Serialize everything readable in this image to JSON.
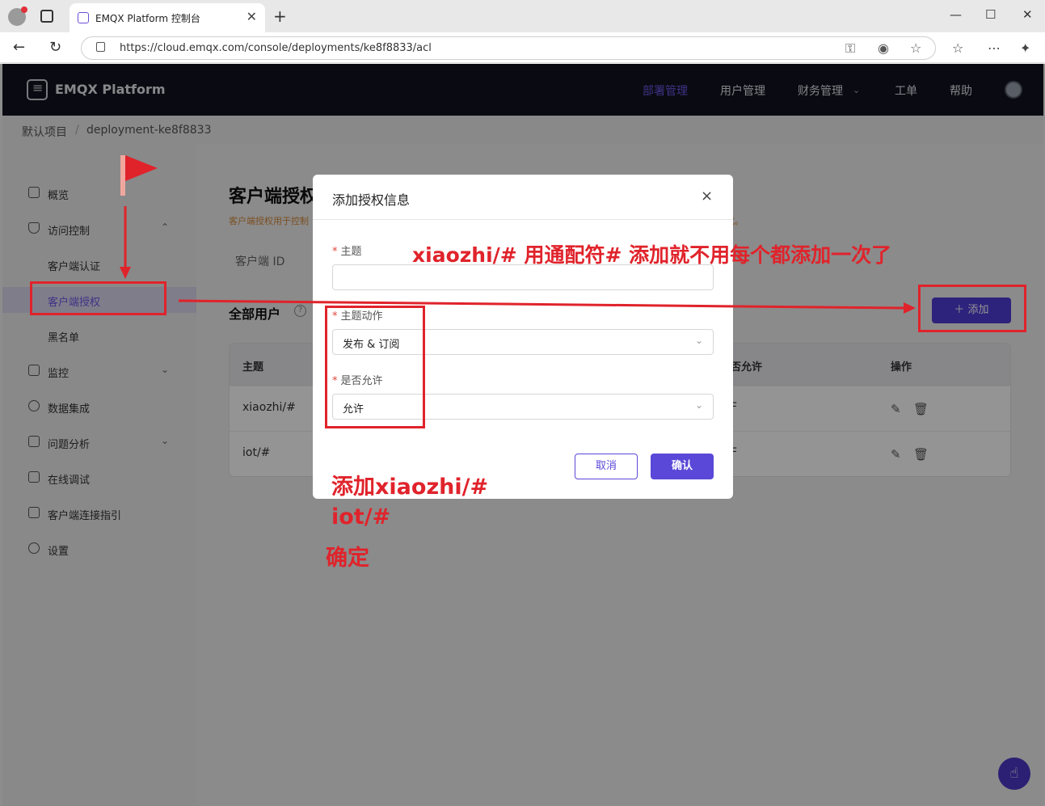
{
  "browser": {
    "tab_title": "EMQX Platform 控制台",
    "url": "https://cloud.emqx.com/console/deployments/ke8f8833/acl"
  },
  "topnav": {
    "logo": "EMQX Platform",
    "items": [
      "部署管理",
      "用户管理",
      "财务管理",
      "工单",
      "帮助"
    ]
  },
  "breadcrumb": {
    "project": "默认项目",
    "separator": "/",
    "deployment": "deployment-ke8f8833"
  },
  "sidebar": {
    "items": [
      {
        "label": "概览"
      },
      {
        "label": "访问控制"
      },
      {
        "label": "客户端认证"
      },
      {
        "label": "客户端授权"
      },
      {
        "label": "黑名单"
      },
      {
        "label": "监控"
      },
      {
        "label": "数据集成"
      },
      {
        "label": "问题分析"
      },
      {
        "label": "在线调试"
      },
      {
        "label": "客户端连接指引"
      },
      {
        "label": "设置"
      }
    ]
  },
  "main": {
    "title": "客户端授权",
    "desc_left": "客户端授权用于控制",
    "desc_right": "式。",
    "subtab": "客户端 ID",
    "section_title": "全部用户",
    "help": "?",
    "add_button": "＋ 添加",
    "table": {
      "headers": [
        "主题",
        "否允许",
        "操作"
      ],
      "rows": [
        {
          "topic": "xiaozhi/#",
          "allow": "F"
        },
        {
          "topic": "iot/#",
          "allow": "F"
        }
      ]
    }
  },
  "modal": {
    "title": "添加授权信息",
    "close": "×",
    "topic_label": "主题",
    "topic_value": "",
    "action_label": "主题动作",
    "action_value": "发布 & 订阅",
    "permission_label": "是否允许",
    "permission_value": "允许",
    "cancel": "取消",
    "confirm": "确认"
  },
  "annotations": {
    "top": "xiaozhi/#  用通配符# 添加就不用每个都添加一次了",
    "line1": "添加xiaozhi/#",
    "line2": "iot/#",
    "line3": "确定"
  },
  "colors": {
    "accent": "#5a48d8",
    "annotation": "#e0232b",
    "nav_bg": "#121420"
  }
}
